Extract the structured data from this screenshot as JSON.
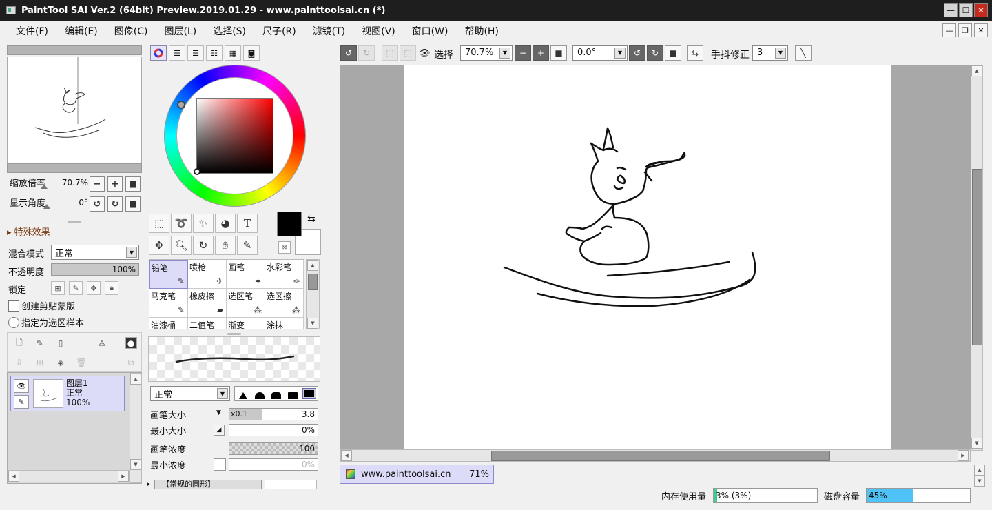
{
  "window": {
    "title": "PaintTool SAI Ver.2 (64bit) Preview.2019.01.29 - www.painttoolsai.cn (*)"
  },
  "menu": [
    "文件(F)",
    "编辑(E)",
    "图像(C)",
    "图层(L)",
    "选择(S)",
    "尺子(R)",
    "滤镜(T)",
    "视图(V)",
    "窗口(W)",
    "帮助(H)"
  ],
  "navigator": {
    "zoom_label": "缩放倍率",
    "zoom_value": "70.7%",
    "angle_label": "显示角度",
    "angle_value": "0°"
  },
  "layer_props": {
    "section_title": "特殊效果",
    "blend_label": "混合模式",
    "blend_value": "正常",
    "opacity_label": "不透明度",
    "opacity_value": "100%",
    "lock_label": "锁定",
    "clip_label": "创建剪贴蒙版",
    "sample_label": "指定为选区样本"
  },
  "layers": [
    {
      "name": "图层1",
      "mode": "正常",
      "opacity": "100%"
    }
  ],
  "brushes": [
    {
      "name": "铅笔",
      "icon": "pencil-icon",
      "glyph": "✎",
      "active": true
    },
    {
      "name": "喷枪",
      "icon": "airbrush-icon",
      "glyph": "✈",
      "active": false
    },
    {
      "name": "画笔",
      "icon": "brush-icon",
      "glyph": "✒",
      "active": false
    },
    {
      "name": "水彩笔",
      "icon": "watercolor-icon",
      "glyph": "✑",
      "active": false
    },
    {
      "name": "马克笔",
      "icon": "marker-icon",
      "glyph": "✎",
      "active": false
    },
    {
      "name": "橡皮擦",
      "icon": "eraser-icon",
      "glyph": "▰",
      "active": false
    },
    {
      "name": "选区笔",
      "icon": "select-pen-icon",
      "glyph": "⁂",
      "active": false
    },
    {
      "name": "选区擦",
      "icon": "select-eraser-icon",
      "glyph": "⁂",
      "active": false
    },
    {
      "name": "油漆桶",
      "icon": "bucket-icon",
      "glyph": "",
      "active": false
    },
    {
      "name": "二值笔",
      "icon": "binary-pen-icon",
      "glyph": "",
      "active": false
    },
    {
      "name": "渐变",
      "icon": "gradient-icon",
      "glyph": "",
      "active": false
    },
    {
      "name": "涂抹",
      "icon": "smudge-icon",
      "glyph": "",
      "active": false
    }
  ],
  "brush_settings": {
    "mode_value": "正常",
    "size_label": "画笔大小",
    "size_multiplier": "x0.1",
    "size_value": "3.8",
    "min_size_label": "最小大小",
    "min_size_value": "0%",
    "density_label": "画笔浓度",
    "density_value": "100",
    "min_density_label": "最小浓度",
    "min_density_value": "0%",
    "shape_label": "【常规的圆形】"
  },
  "canvas_toolbar": {
    "select_label": "选择",
    "zoom_value": "70.7%",
    "angle_value": "0.0°",
    "stabilizer_label": "手抖修正",
    "stabilizer_value": "3"
  },
  "document_tab": {
    "name": "www.painttoolsai.cn",
    "zoom": "71%"
  },
  "status": {
    "memory_label": "内存使用量",
    "memory_value": "3% (3%)",
    "memory_fraction": 0.03,
    "disk_label": "磁盘容量",
    "disk_value": "45%",
    "disk_fraction": 0.45
  },
  "colors": {
    "primary_fg": "#000000",
    "primary_bg": "#ffffff",
    "selection_bg": "#dcdcf8",
    "disk_meter": "#4fc3f7",
    "memory_meter": "#3ecf8e",
    "close_button": "#c42b1c"
  }
}
